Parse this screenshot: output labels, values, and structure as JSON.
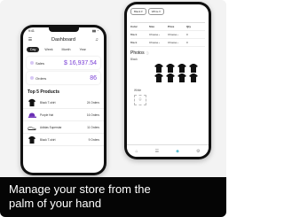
{
  "front_phone": {
    "status_time": "9:41",
    "status_icons": "▮▮ ◔",
    "menu_icon": "menu-icon",
    "bell_icon": "bell-icon",
    "title": "Dashboard",
    "periods": [
      "Day",
      "Week",
      "Month",
      "Year"
    ],
    "metrics": [
      {
        "label": "Sales",
        "value": "$ 16,937.54"
      },
      {
        "label": "Orders",
        "value": "86"
      }
    ],
    "top_products_title": "Top 5 Products",
    "products": [
      {
        "name": "Black T-shirt",
        "orders": "24 Orders",
        "color": "#111111"
      },
      {
        "name": "Purple Hat",
        "orders": "16 Orders",
        "color": "#6a2fb5"
      },
      {
        "name": "Adidas Superstar",
        "orders": "11 Orders",
        "color": "#e8e8e8"
      },
      {
        "name": "Black T-shirt",
        "orders": "9 Orders",
        "color": "#111111"
      }
    ]
  },
  "back_phone": {
    "filters": [
      "Black ▾",
      "White ▾"
    ],
    "variants_header": [
      "Color",
      "Size",
      "Price",
      "Qty"
    ],
    "variants_rows": [
      [
        "Black",
        "Choose ›",
        "Choose ›",
        "0"
      ],
      [
        "Black",
        "Choose ›",
        "Choose ›",
        "0"
      ]
    ],
    "photos_title": "Photos",
    "black_label": "Black",
    "white_label": "White",
    "tabs": [
      "Home",
      "Orders",
      "Products",
      "Settings"
    ]
  },
  "caption": {
    "line1": "Manage your store from the",
    "line2": "palm of your hand"
  },
  "colors": {
    "accent": "#7a3fd6",
    "banner": "#050505"
  }
}
